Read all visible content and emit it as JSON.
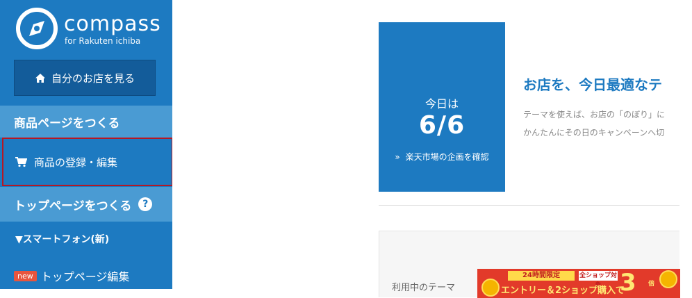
{
  "brand": {
    "name": "compass",
    "subtitle": "for Rakuten ichiba"
  },
  "sidebar": {
    "shop_button": {
      "label": "自分のお店を見る",
      "icon": "home-icon"
    },
    "section_product": {
      "title": "商品ページをつくる"
    },
    "product_item": {
      "label": "商品の登録・編集",
      "icon": "cart-icon"
    },
    "section_top": {
      "title": "トップページをつくる",
      "help": "?"
    },
    "smartphone_heading": "▼スマートフォン(新)",
    "top_edit": {
      "badge": "new",
      "label": "トップページ編集"
    }
  },
  "main": {
    "date_box": {
      "label": "今日は",
      "value": "6/6",
      "link_arrow": "»",
      "link": "楽天市場の企画を確認"
    },
    "headline": "お店を、今日最適なテ",
    "description": [
      "テーマを使えば、お店の「のぼり」に",
      "かんたんにその日のキャンペーンへ切"
    ],
    "theme_label": "利用中のテーマ",
    "banner": {
      "tag1": "24時間限定",
      "tag2": "全ショップ対象",
      "main": "エントリー＆2ショップ購入で",
      "big": "3",
      "small": "倍"
    }
  },
  "colors": {
    "accent": "#1d7ac1",
    "accent_light": "#4a9bd3",
    "highlight_border": "#b61824",
    "new_badge": "#e8553e"
  }
}
